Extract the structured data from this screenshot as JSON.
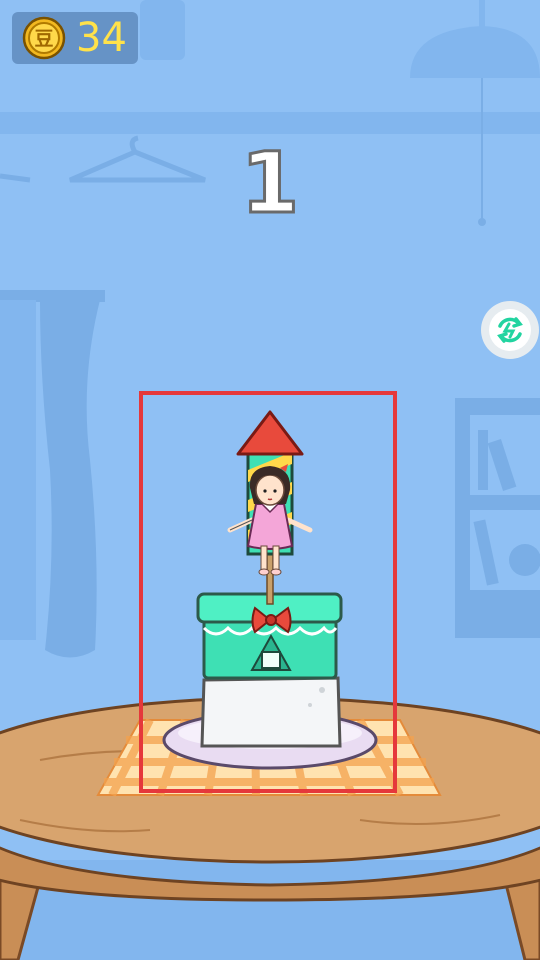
{
  "hud": {
    "coin_count": "34",
    "coin_icon": "gold-coin-icon",
    "coin_glyph": "豆"
  },
  "level": {
    "number": "1"
  },
  "controls": {
    "refresh_icon": "refresh-icon"
  },
  "colors": {
    "sky": "#8fc0f4",
    "coin_text": "#ffe24a",
    "target_box": "#e5383b",
    "cake_box": "#3ee0b4",
    "rocket_tip": "#e84a3c",
    "table": "#d8a46e"
  }
}
